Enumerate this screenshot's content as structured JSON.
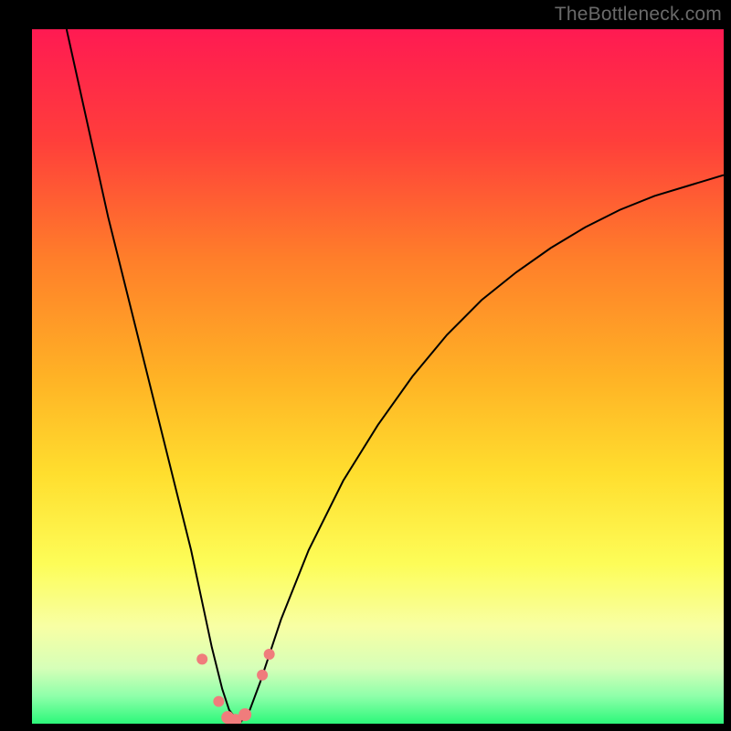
{
  "watermark": "TheBottleneck.com",
  "chart_data": {
    "type": "line",
    "title": "",
    "xlabel": "",
    "ylabel": "",
    "xlim": [
      0,
      100
    ],
    "ylim": [
      0,
      100
    ],
    "background_gradient": {
      "stops": [
        {
          "offset": 0.0,
          "color": "#ff1a52"
        },
        {
          "offset": 0.16,
          "color": "#ff3e3b"
        },
        {
          "offset": 0.33,
          "color": "#ff7e2a"
        },
        {
          "offset": 0.5,
          "color": "#ffb225"
        },
        {
          "offset": 0.64,
          "color": "#ffde2e"
        },
        {
          "offset": 0.77,
          "color": "#fdfd58"
        },
        {
          "offset": 0.86,
          "color": "#f8ffa4"
        },
        {
          "offset": 0.92,
          "color": "#d6ffb8"
        },
        {
          "offset": 0.96,
          "color": "#8fffaa"
        },
        {
          "offset": 1.0,
          "color": "#2cf87a"
        }
      ]
    },
    "series": [
      {
        "name": "curve",
        "color": "#000000",
        "x": [
          5,
          7,
          9,
          11,
          13,
          15,
          17,
          19,
          21,
          23,
          24.5,
          26,
          27.5,
          28.5,
          30,
          31.5,
          33,
          36,
          40,
          45,
          50,
          55,
          60,
          65,
          70,
          75,
          80,
          85,
          90,
          95,
          100
        ],
        "y": [
          100,
          91,
          82,
          73,
          65,
          57,
          49,
          41,
          33,
          25,
          18,
          11,
          5,
          2,
          0,
          2,
          6,
          15,
          25,
          35,
          43,
          50,
          56,
          61,
          65,
          68.5,
          71.5,
          74,
          76,
          77.5,
          79
        ]
      }
    ],
    "markers": {
      "color": "#f07c7c",
      "radius_small": 6,
      "radius_large": 7,
      "points": [
        {
          "x": 24.6,
          "y": 9.3,
          "r": "small"
        },
        {
          "x": 27.0,
          "y": 3.2,
          "r": "small"
        },
        {
          "x": 28.3,
          "y": 0.9,
          "r": "large"
        },
        {
          "x": 29.4,
          "y": 0.5,
          "r": "large"
        },
        {
          "x": 30.8,
          "y": 1.3,
          "r": "large"
        },
        {
          "x": 33.3,
          "y": 7.0,
          "r": "small"
        },
        {
          "x": 34.3,
          "y": 10.0,
          "r": "small"
        }
      ]
    }
  }
}
